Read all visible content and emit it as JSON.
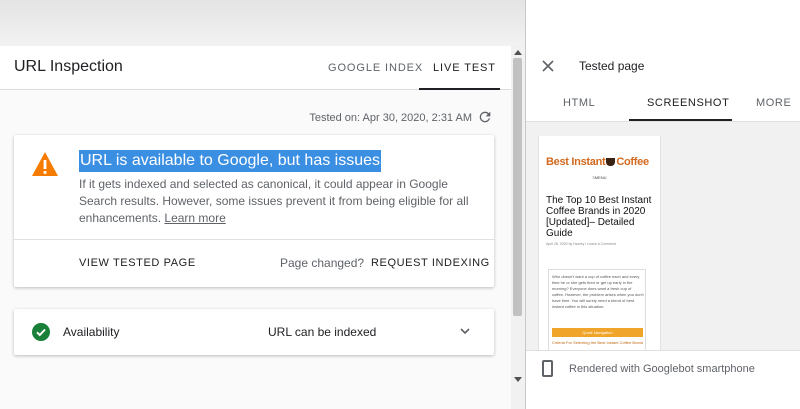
{
  "left_panel": {
    "title": "URL Inspection",
    "tabs": [
      {
        "label": "GOOGLE INDEX",
        "active": false
      },
      {
        "label": "LIVE TEST",
        "active": true
      }
    ],
    "tested_on": "Tested on: Apr 30, 2020, 2:31 AM",
    "issue_card": {
      "title": "URL is available to Google, but has issues",
      "description": "If it gets indexed and selected as canonical, it could appear in Google Search results. However, some issues prevent it from being eligible for all enhancements.",
      "learn_more": "Learn more",
      "view_tested_page": "VIEW TESTED PAGE",
      "page_changed": "Page changed?",
      "request_indexing": "REQUEST INDEXING"
    },
    "availability": {
      "label": "Availability",
      "value": "URL can be indexed"
    }
  },
  "right_panel": {
    "title": "Tested page",
    "tabs": [
      {
        "label": "HTML",
        "active": false
      },
      {
        "label": "SCREENSHOT",
        "active": true
      },
      {
        "label": "MORE",
        "active": false
      }
    ],
    "screenshot": {
      "logo_left": "Best Instant",
      "logo_right": "Coffee",
      "menu": "MENU",
      "article_title": "The Top 10 Best Instant Coffee Brands in 2020 [Updated]– Detailed Guide",
      "article_meta": "April 28, 2020 by Harvey / Leave a Comment",
      "box_text": "Who doesn't want a cup of coffee each and every time he or she gets tired or get up early in the morning? Everyone does want a fresh cup of coffee. However, the problem arises when you don't have time. You will surely need a blend of best instant coffee in this situation.",
      "box_button": "Quick Navigation",
      "box_link": "Criteria For Selecting the Best Instant Coffee Brand"
    },
    "footer": "Rendered with Googlebot smartphone"
  },
  "colors": {
    "warning": "#f57c00",
    "success": "#188038",
    "highlight": "#3b8fe3"
  }
}
